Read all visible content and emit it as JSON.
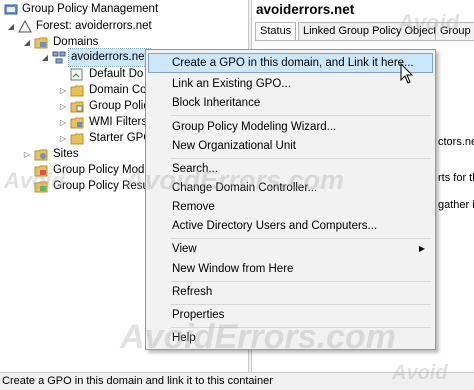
{
  "tree": {
    "root": "Group Policy Management",
    "forest": "Forest: avoiderrors.net",
    "domains": "Domains",
    "domain": "avoiderrors.net",
    "children": [
      "Default Do",
      "Domain Co",
      "Group Polic",
      "WMI Filters",
      "Starter GPO"
    ],
    "sites": "Sites",
    "modeling": "Group Policy Mod",
    "results": "Group Policy Resu"
  },
  "right": {
    "title": "avoiderrors.net",
    "tabs": [
      "Status",
      "Linked Group Policy Objects",
      "Group Po"
    ],
    "fragments": [
      "ctors.net",
      "rts for thi",
      "gather inf"
    ]
  },
  "menu": {
    "items": [
      "Create a GPO in this domain, and Link it here...",
      "Link an Existing GPO...",
      "Block Inheritance",
      "Group Policy Modeling Wizard...",
      "New Organizational Unit",
      "Search...",
      "Change Domain Controller...",
      "Remove",
      "Active Directory Users and Computers...",
      "View",
      "New Window from Here",
      "Refresh",
      "Properties",
      "Help"
    ],
    "highlighted_index": 0,
    "submenu_item_index": 9
  },
  "statusbar": {
    "text": "Create a GPO in this domain and link it to this container"
  },
  "watermark": {
    "text": "AvoidErrors.com",
    "short": "Avoid"
  },
  "colors": {
    "highlight": "#cce8ff",
    "highlight_border": "#7da2ce",
    "menu_bg": "#f2f2f2",
    "folder": "#e8c15a"
  }
}
